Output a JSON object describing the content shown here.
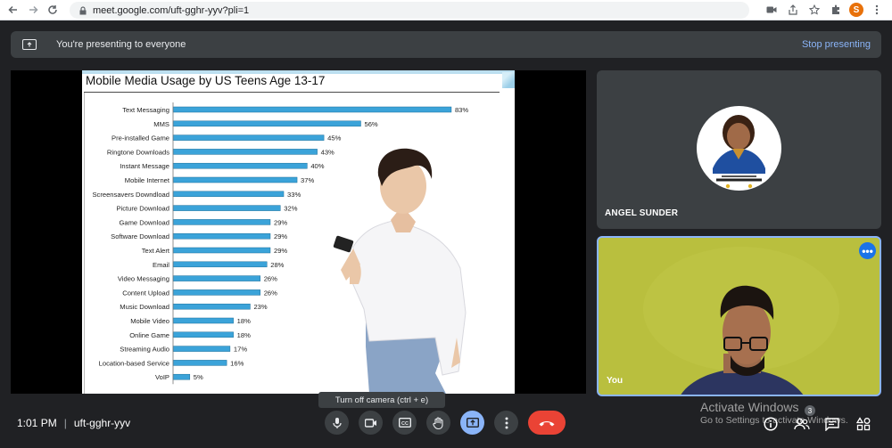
{
  "browser": {
    "url": "meet.google.com/uft-gghr-yyv?pli=1",
    "profile_initial": "S",
    "profile_color": "#e8710a"
  },
  "banner": {
    "text": "You're presenting to everyone",
    "stop_label": "Stop presenting"
  },
  "slide": {
    "title": "Mobile Media Usage by US Teens Age 13-17"
  },
  "chart_data": {
    "type": "bar",
    "orientation": "horizontal",
    "title": "Mobile Media Usage by US Teens Age 13-17",
    "categories": [
      "Text Messaging",
      "MMS",
      "Pre-installed Game",
      "Ringtone Downloads",
      "Instant Message",
      "Mobile Internet",
      "Screensavers Downdload",
      "Picture Download",
      "Game Download",
      "Software Download",
      "Text Alert",
      "Email",
      "Video Messaging",
      "Content Upload",
      "Music Download",
      "Mobile Video",
      "Online Game",
      "Streaming Audio",
      "Location-based Service",
      "VoIP"
    ],
    "values": [
      83,
      56,
      45,
      43,
      40,
      37,
      33,
      32,
      29,
      29,
      29,
      28,
      26,
      26,
      23,
      18,
      18,
      17,
      16,
      5
    ],
    "value_labels": [
      "83%",
      "56%",
      "45%",
      "43%",
      "40%",
      "37%",
      "33%",
      "32%",
      "29%",
      "29%",
      "29%",
      "28%",
      "26%",
      "26%",
      "23%",
      "18%",
      "18%",
      "17%",
      "16%",
      "5%"
    ],
    "bar_color": "#3ba3d9",
    "xlim": [
      0,
      100
    ]
  },
  "participants": {
    "other_name": "ANGEL SUNDER",
    "self_label": "You"
  },
  "tooltip": "Turn off camera (ctrl + e)",
  "meeting": {
    "time": "1:01 PM",
    "code": "uft-gghr-yyv",
    "participant_count": "3"
  },
  "watermark": {
    "line1": "Activate Windows",
    "line2": "Go to Settings to activate Windows."
  },
  "icons": {
    "mic": "mic-icon",
    "camera": "camera-icon",
    "captions": "captions-icon",
    "hand": "raise-hand-icon",
    "present": "present-icon",
    "more": "more-vert-icon",
    "hangup": "hangup-icon"
  }
}
